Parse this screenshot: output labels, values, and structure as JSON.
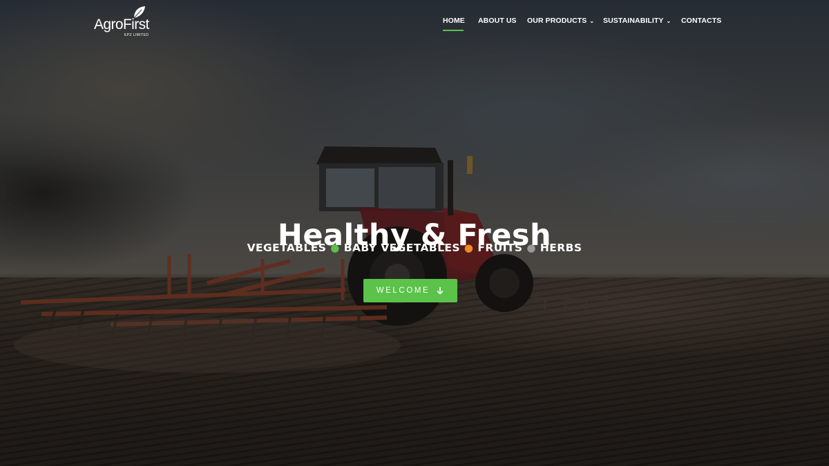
{
  "brand": {
    "name": "AgroFirst",
    "subtitle": "EPZ LIMITED"
  },
  "nav": {
    "items": [
      {
        "label": "HOME",
        "active": true,
        "dropdown": false
      },
      {
        "label": "ABOUT US",
        "active": false,
        "dropdown": false
      },
      {
        "label": "OUR PRODUCTS",
        "active": false,
        "dropdown": true
      },
      {
        "label": "SUSTAINABILITY",
        "active": false,
        "dropdown": true
      },
      {
        "label": "CONTACTS",
        "active": false,
        "dropdown": false
      }
    ],
    "chevron_icon": "chevron-down-icon"
  },
  "hero": {
    "title": "Healthy & Fresh",
    "categories": [
      {
        "label": "VEGETABLES",
        "dot_color": "#5bc24a"
      },
      {
        "label": "BABY VEGETABLES",
        "dot_color": "#f08a24"
      },
      {
        "label": "FRUITS",
        "dot_color": "#9a9a9a"
      },
      {
        "label": "HERBS",
        "dot_color": null
      }
    ],
    "cta_label": "WELCOME",
    "cta_icon": "arrow-down-icon"
  },
  "colors": {
    "accent": "#5bc24a"
  }
}
